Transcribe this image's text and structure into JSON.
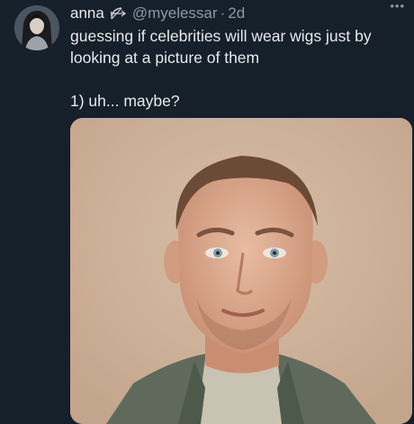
{
  "tweet": {
    "display_name": "anna",
    "handle": "@myelessar",
    "separator": "·",
    "time": "2d",
    "more_label": "•••",
    "text_line1": "guessing if celebrities will wear wigs just by looking at a picture of them",
    "text_line2": "1) uh... maybe?"
  },
  "icons": {
    "badge": "bow-and-arrow-icon",
    "more": "more-options-icon"
  },
  "colors": {
    "background": "#15202b",
    "text": "#e7e9ea",
    "secondary_text": "#8b98a5",
    "photo_background": "#cdb29a"
  }
}
